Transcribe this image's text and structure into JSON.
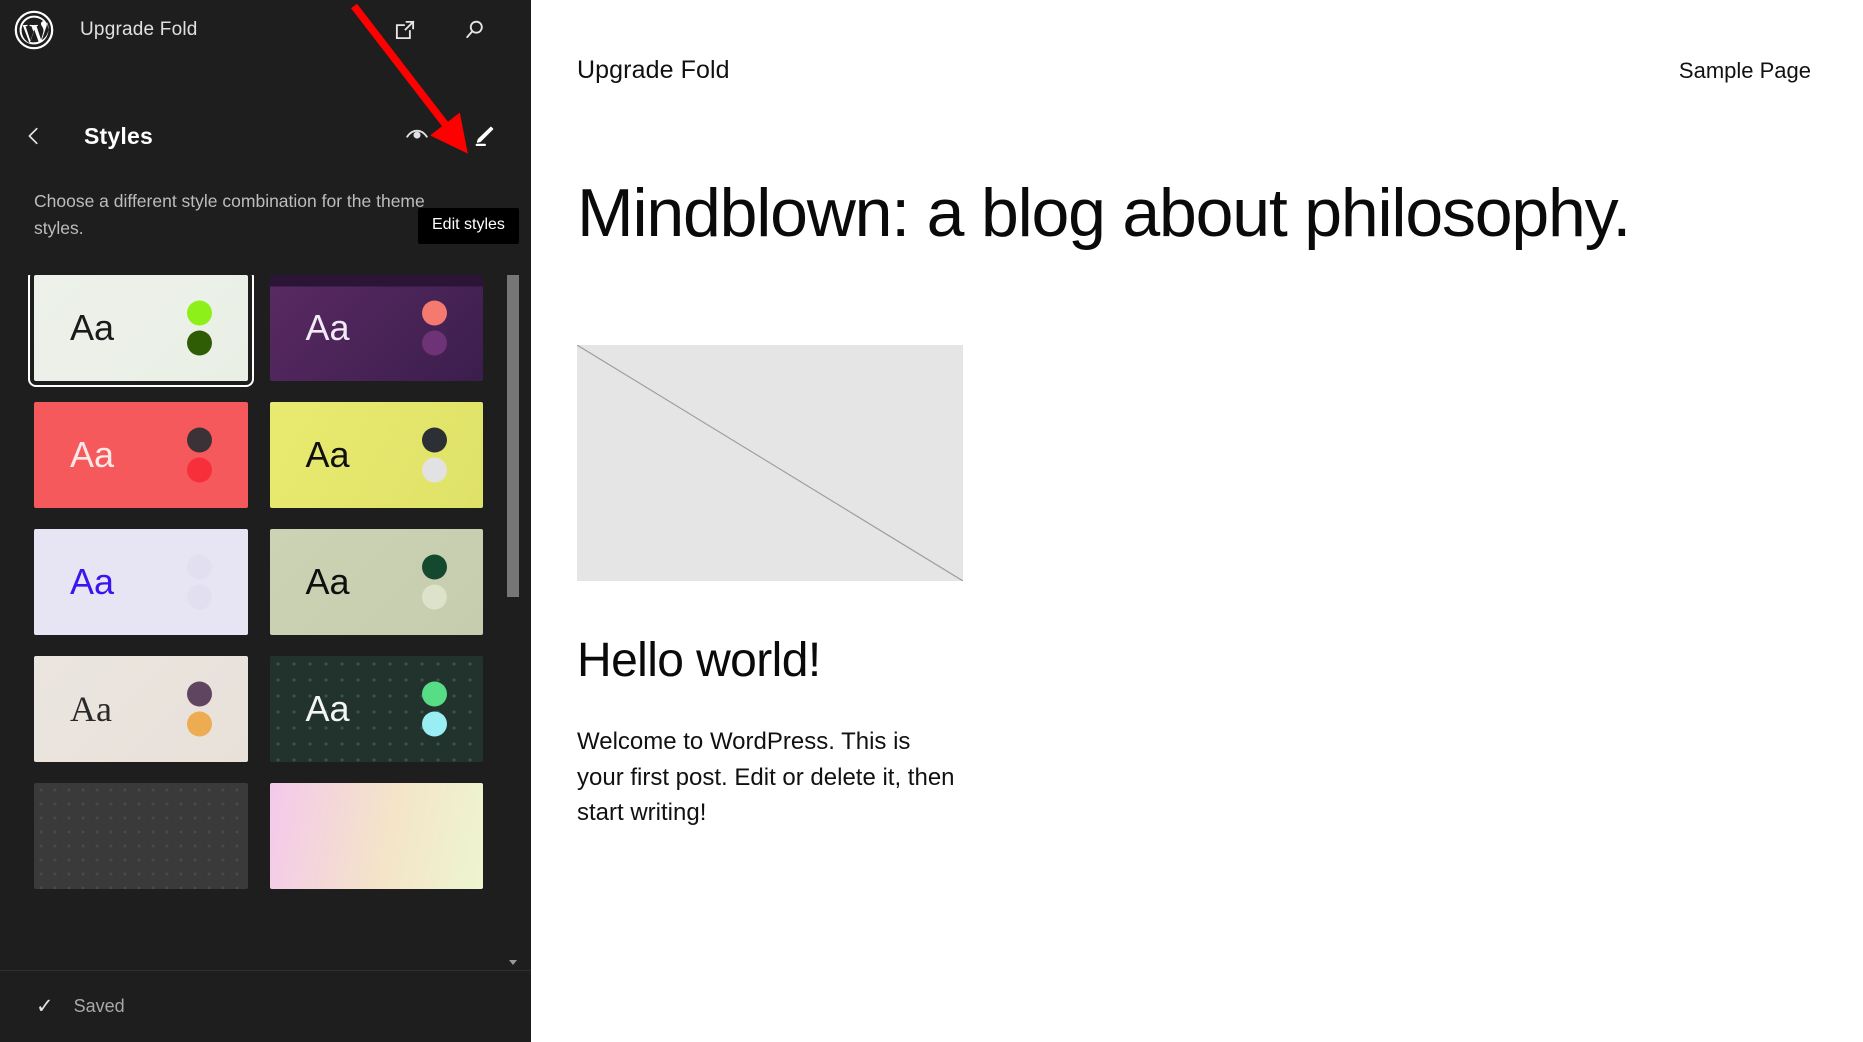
{
  "editor": {
    "topbar": {
      "logo_icon": "wordpress-logo-icon",
      "site_title": "Upgrade Fold",
      "view_site_icon": "external-link-icon",
      "search_icon": "search-icon"
    },
    "panel": {
      "back_icon": "chevron-left-icon",
      "title": "Styles",
      "preview_icon": "eye-icon",
      "edit_icon": "pencil-icon",
      "tooltip": "Edit styles",
      "description": "Choose a different style combination for the theme styles."
    },
    "variations": [
      {
        "name": "style-variation-1",
        "sample_text": "Aa",
        "selected": true,
        "background": "linear-gradient(135deg,#edf1ea 0%,#eaefe6 100%)",
        "text_color": "#1b1b1b",
        "font_style": "sans",
        "dots": [
          "#8df119",
          "#2f5d05"
        ],
        "pattern": "none"
      },
      {
        "name": "style-variation-2",
        "sample_text": "Aa",
        "selected": false,
        "background": "linear-gradient(135deg,#5a2a63 0%,#3b1e4d 100%)",
        "text_color": "#f2eaf4",
        "font_style": "sans",
        "dots": [
          "#f4796e",
          "#6e3277"
        ],
        "pattern": "top-band"
      },
      {
        "name": "style-variation-3",
        "sample_text": "Aa",
        "selected": false,
        "background": "#f6595b",
        "text_color": "#fbe9e8",
        "font_style": "sans",
        "dots": [
          "#3b3237",
          "#f62f3a"
        ],
        "pattern": "none"
      },
      {
        "name": "style-variation-4",
        "sample_text": "Aa",
        "selected": false,
        "background": "linear-gradient(120deg,#e9eb70 0%,#dfe268 100%)",
        "text_color": "#101010",
        "font_style": "sans",
        "dots": [
          "#2c2f33",
          "#e2e2e2"
        ],
        "pattern": "none"
      },
      {
        "name": "style-variation-5",
        "sample_text": "Aa",
        "selected": false,
        "background": "#e7e5f3",
        "text_color": "#3b14f0",
        "font_style": "sans",
        "dots": [
          "#e2e0f0",
          "#e2e0f0"
        ],
        "pattern": "none"
      },
      {
        "name": "style-variation-6",
        "sample_text": "Aa",
        "selected": false,
        "background": "linear-gradient(135deg,#ccd2b4 0%,#c6ccae 100%)",
        "text_color": "#0f0f0f",
        "font_style": "sans",
        "dots": [
          "#15492f",
          "#dde2cb"
        ],
        "pattern": "none"
      },
      {
        "name": "style-variation-7",
        "sample_text": "Aa",
        "selected": false,
        "background": "linear-gradient(135deg,#ebe5df 0%,#e8e1da 100%)",
        "text_color": "#2a2a2a",
        "font_style": "serif",
        "dots": [
          "#5f4560",
          "#edab52"
        ],
        "pattern": "none"
      },
      {
        "name": "style-variation-8",
        "sample_text": "Aa",
        "selected": false,
        "background": "#22332d",
        "text_color": "#f3f6f3",
        "font_style": "sans",
        "dots": [
          "#56dd86",
          "#98eef3"
        ],
        "pattern": "dots"
      },
      {
        "name": "style-variation-9",
        "sample_text": "",
        "selected": false,
        "background": "#3a3a3a",
        "text_color": "#e8e8e8",
        "font_style": "sans",
        "dots": [],
        "pattern": "dots-faint"
      },
      {
        "name": "style-variation-10",
        "sample_text": "",
        "selected": false,
        "background": "linear-gradient(100deg,#f4c9ec 0%,#f4e4c8 55%,#edf5cf 100%)",
        "text_color": "#222222",
        "font_style": "sans",
        "dots": [],
        "pattern": "none"
      }
    ],
    "save_bar": {
      "check_icon": "check-icon",
      "status": "Saved"
    },
    "scrollbar": {
      "down_arrow_icon": "chevron-down-icon"
    }
  },
  "preview": {
    "site_name": "Upgrade Fold",
    "nav": [
      {
        "label": "Sample Page"
      }
    ],
    "tagline": "Mindblown: a blog about philosophy.",
    "post": {
      "media_placeholder_icon": "image-placeholder-icon",
      "title": "Hello world!",
      "excerpt": "Welcome to WordPress. This is your first post. Edit or delete it, then start writing!"
    }
  },
  "annotation": {
    "arrow_color": "#ff0000",
    "arrow_icon": "pointer-arrow-icon"
  }
}
